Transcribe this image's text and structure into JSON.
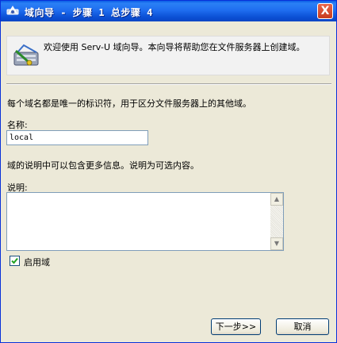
{
  "window": {
    "title": "域向导 - 步骤 1 总步骤 4",
    "close_label": "X"
  },
  "banner": {
    "text": "欢迎使用 Serv-U 域向导。本向导将帮助您在文件服务器上创建域。"
  },
  "form": {
    "intro": "每个域名都是唯一的标识符，用于区分文件服务器上的其他域。",
    "name_label": "名称:",
    "name_value": "local",
    "desc_info": "域的说明中可以包含更多信息。说明为可选内容。",
    "desc_label": "说明:",
    "desc_value": "",
    "enable_label": "启用域",
    "enable_checked": true
  },
  "buttons": {
    "next": "下一步>>",
    "cancel": "取消"
  }
}
